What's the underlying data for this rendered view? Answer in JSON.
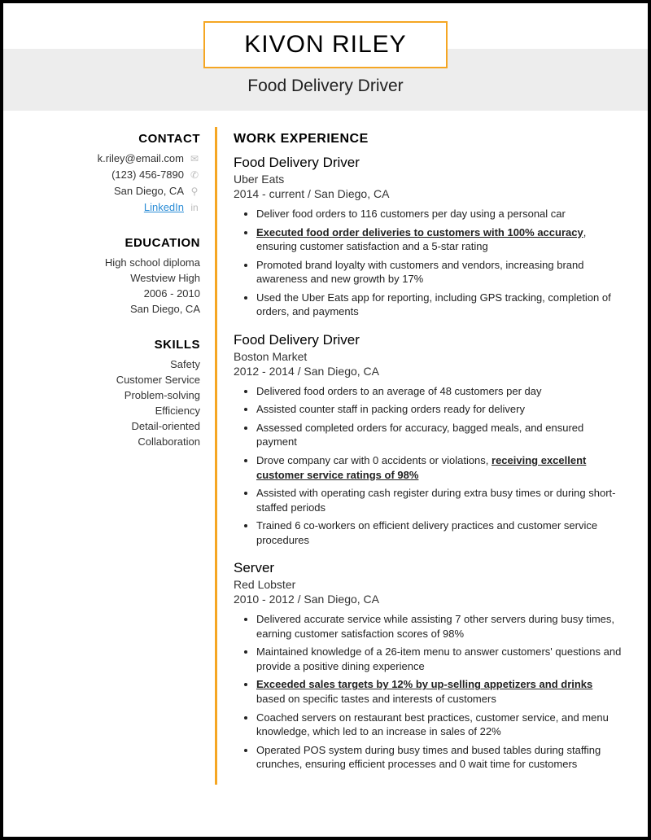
{
  "name": "KIVON RILEY",
  "title": "Food Delivery Driver",
  "sections": {
    "contact": "CONTACT",
    "education": "EDUCATION",
    "skills": "SKILLS",
    "work": "WORK EXPERIENCE"
  },
  "contact": {
    "email": "k.riley@email.com",
    "phone": "(123) 456-7890",
    "location": "San Diego, CA",
    "linkedin": "LinkedIn"
  },
  "education": {
    "degree": "High school diploma",
    "school": "Westview High",
    "dates": "2006 - 2010",
    "location": "San Diego, CA"
  },
  "skills": [
    "Safety",
    "Customer Service",
    "Problem-solving",
    "Efficiency",
    "Detail-oriented",
    "Collaboration"
  ],
  "jobs": [
    {
      "title": "Food Delivery Driver",
      "company": "Uber Eats",
      "dates": "2014 - current",
      "location": "San Diego, CA",
      "bullets": [
        {
          "pre": "Deliver food orders to 116 customers per day using a personal car"
        },
        {
          "hl": "Executed food order deliveries to customers with 100% accuracy",
          "post": ", ensuring customer satisfaction and a 5-star rating"
        },
        {
          "pre": "Promoted brand loyalty with customers and vendors, increasing brand awareness and new growth by 17%"
        },
        {
          "pre": "Used the Uber Eats app for reporting, including GPS tracking, completion of orders, and payments"
        }
      ]
    },
    {
      "title": "Food Delivery Driver",
      "company": "Boston Market",
      "dates": "2012 - 2014",
      "location": "San Diego, CA",
      "bullets": [
        {
          "pre": "Delivered food orders to an average of 48 customers per day"
        },
        {
          "pre": "Assisted counter staff in packing orders ready for delivery"
        },
        {
          "pre": "Assessed completed orders for accuracy, bagged meals, and ensured payment"
        },
        {
          "pre": "Drove company car with 0 accidents or violations, ",
          "hl": "receiving excellent customer service ratings of 98%"
        },
        {
          "pre": "Assisted with operating cash register during extra busy times or during short-staffed periods"
        },
        {
          "pre": "Trained 6 co-workers on efficient delivery practices and customer service procedures"
        }
      ]
    },
    {
      "title": "Server",
      "company": "Red Lobster",
      "dates": "2010 - 2012",
      "location": "San Diego, CA",
      "bullets": [
        {
          "pre": "Delivered accurate service while assisting 7 other servers during busy times, earning customer satisfaction scores of 98%"
        },
        {
          "pre": "Maintained knowledge of a 26-item menu to answer customers' questions and provide a positive dining experience"
        },
        {
          "hl": "Exceeded sales targets by 12% by up-selling appetizers and drinks",
          "post": " based on specific tastes and interests of customers"
        },
        {
          "pre": "Coached servers on restaurant best practices, customer service, and menu knowledge, which led to an increase in sales of 22%"
        },
        {
          "pre": "Operated POS system during busy times and bused tables during staffing crunches, ensuring efficient processes and 0 wait time for customers"
        }
      ]
    }
  ]
}
